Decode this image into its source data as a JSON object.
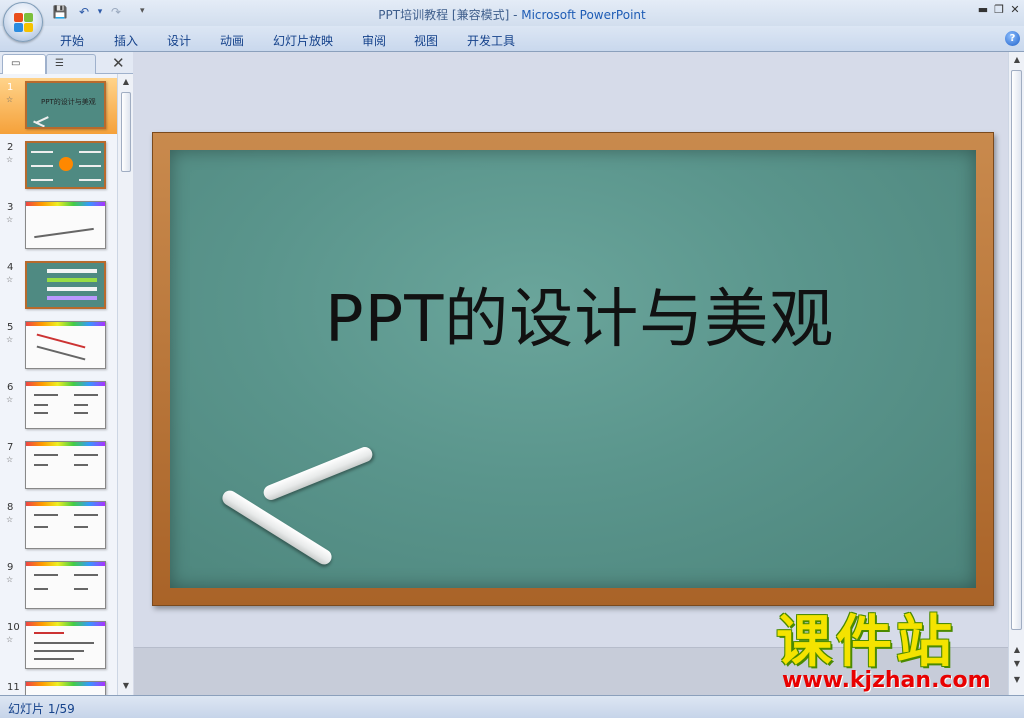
{
  "window": {
    "title_doc": "PPT培训教程 [兼容模式]",
    "title_sep": " - ",
    "title_app": "Microsoft PowerPoint",
    "min_symbol": "▬",
    "restore_symbol": "❐",
    "close_symbol": "✕"
  },
  "quick_access": {
    "save_icon": "💾",
    "undo_icon": "↶",
    "redo_icon": "↷",
    "dropdown_icon": "▾"
  },
  "ribbon": {
    "tabs": [
      "开始",
      "插入",
      "设计",
      "动画",
      "幻灯片放映",
      "审阅",
      "视图",
      "开发工具"
    ],
    "help_symbol": "?"
  },
  "left_pane": {
    "close_symbol": "✕",
    "thumbnails": [
      {
        "num": "1",
        "caption": "PPT的设计与美观"
      },
      {
        "num": "2"
      },
      {
        "num": "3"
      },
      {
        "num": "4"
      },
      {
        "num": "5"
      },
      {
        "num": "6"
      },
      {
        "num": "7"
      },
      {
        "num": "8"
      },
      {
        "num": "9"
      },
      {
        "num": "10"
      },
      {
        "num": "11"
      }
    ]
  },
  "slide": {
    "title": "PPT的设计与美观"
  },
  "status": {
    "slide_counter": "幻灯片 1/59"
  },
  "watermark": {
    "text": "课件站",
    "url": "www.kjzhan.com"
  }
}
